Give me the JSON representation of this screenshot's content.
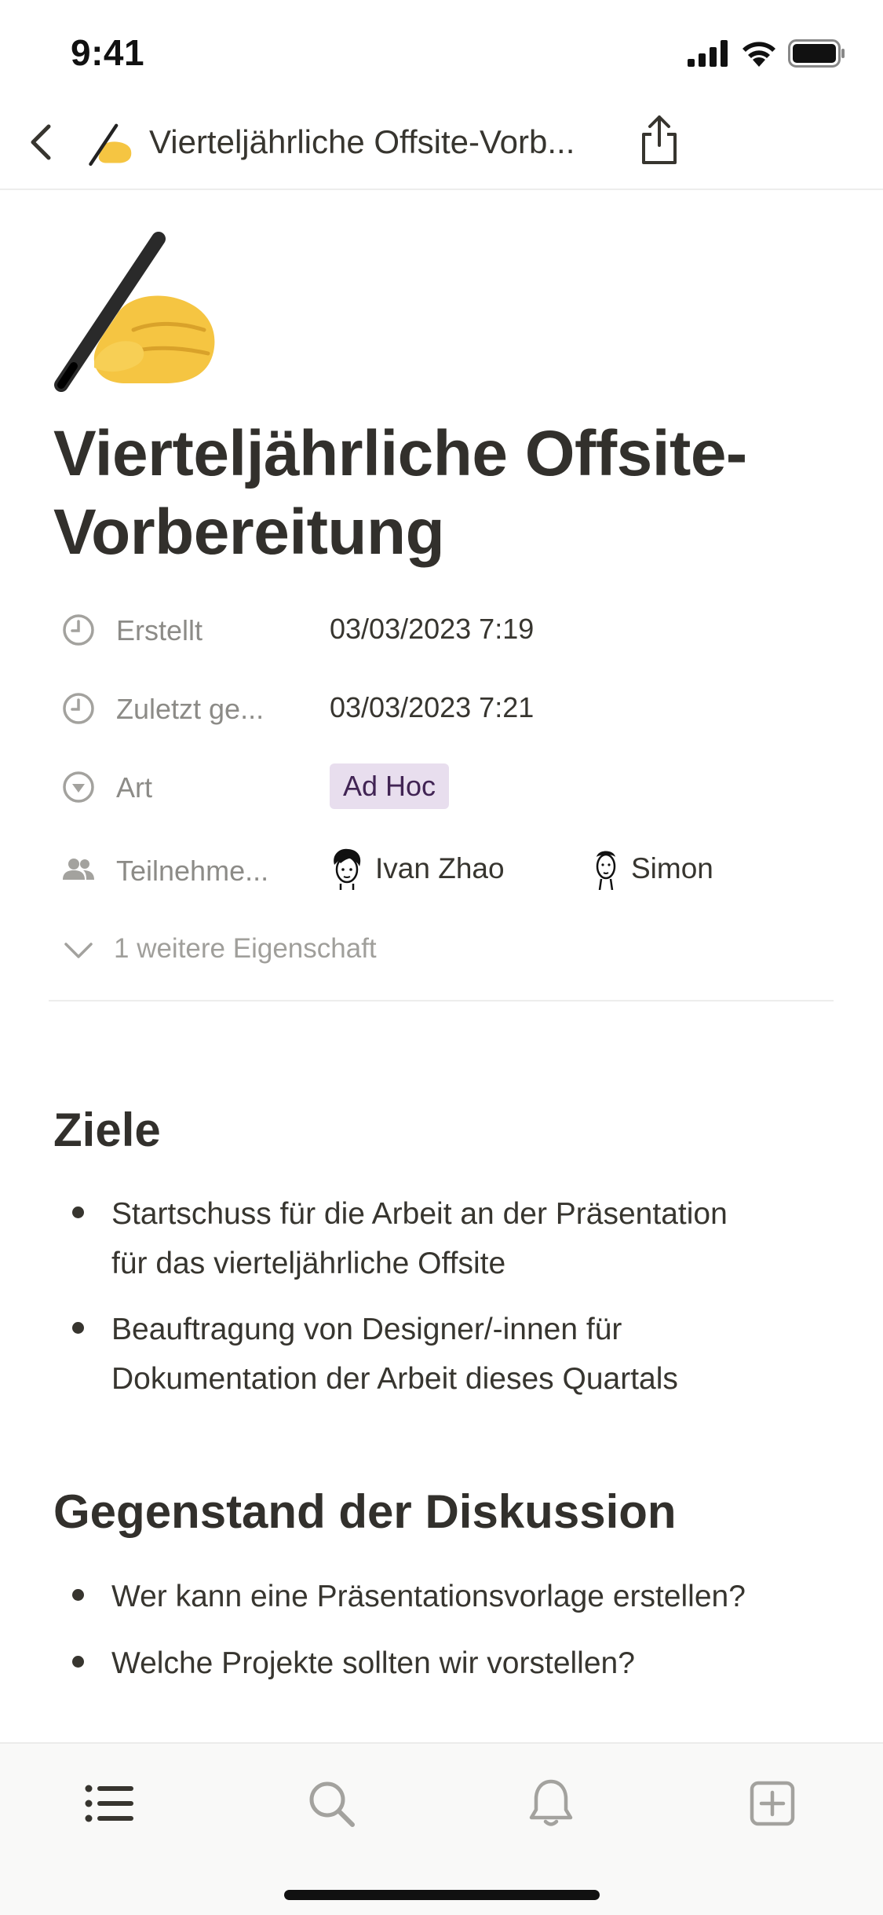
{
  "status": {
    "time": "9:41"
  },
  "nav": {
    "title": "Vierteljährliche Offsite-Vorb..."
  },
  "page": {
    "title_line1": "Vierteljährliche Offsite-",
    "title_line2": "Vorbereitung"
  },
  "properties": {
    "created": {
      "label": "Erstellt",
      "value": "03/03/2023 7:19"
    },
    "edited": {
      "label": "Zuletzt ge...",
      "value": "03/03/2023 7:21"
    },
    "type": {
      "label": "Art",
      "value": "Ad Hoc"
    },
    "participants": {
      "label": "Teilnehme...",
      "people": [
        "Ivan Zhao",
        "Simon"
      ]
    },
    "more": "1 weitere Eigenschaft"
  },
  "sections": [
    {
      "heading": "Ziele",
      "items": [
        [
          "Startschuss für die Arbeit an der Präsentation",
          "für das vierteljährliche Offsite"
        ],
        [
          "Beauftragung von Designer/-innen für",
          "Dokumentation der Arbeit dieses Quartals"
        ]
      ]
    },
    {
      "heading": "Gegenstand der Diskussion",
      "items": [
        [
          "Wer kann eine Präsentationsvorlage erstellen?"
        ],
        [
          "Welche Projekte sollten wir vorstellen?"
        ]
      ]
    }
  ],
  "colors": {
    "text": "#37352f",
    "muted": "#8c8b87",
    "tag_bg": "#e8deee",
    "tag_text": "#412454"
  },
  "tabs": [
    "list-icon",
    "search-icon",
    "bell-icon",
    "new-page-icon"
  ]
}
